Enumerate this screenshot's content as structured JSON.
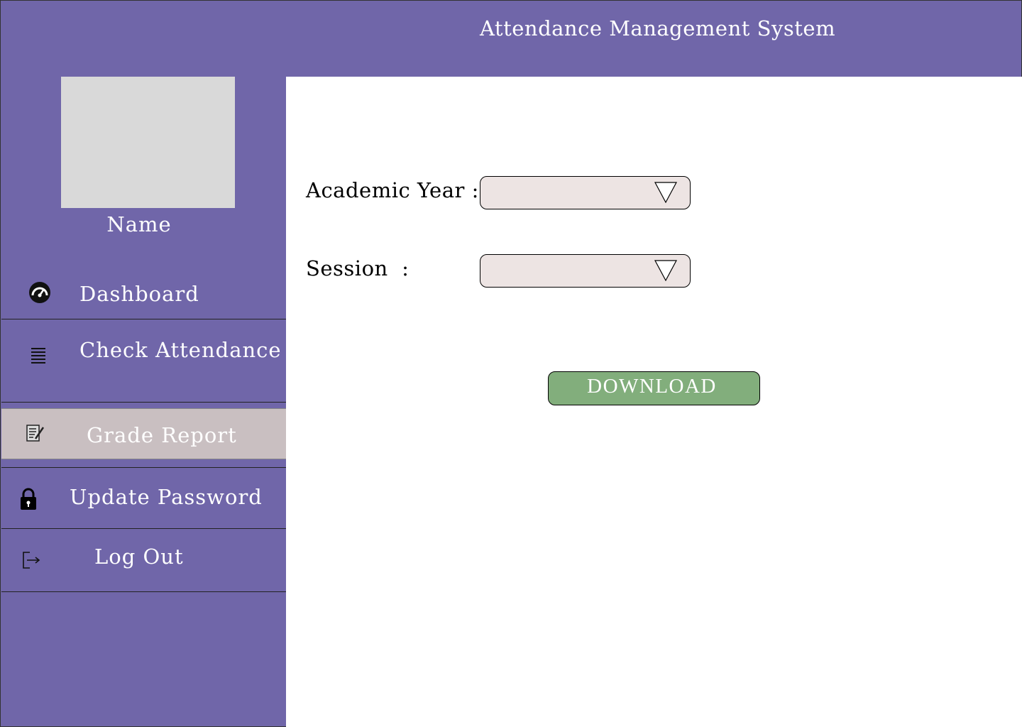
{
  "header": {
    "title": "Attendance Management System"
  },
  "profile": {
    "name": "Name"
  },
  "sidebar": {
    "items": [
      {
        "label": "Dashboard",
        "icon": "dashboard-gauge-icon"
      },
      {
        "label": "Check Attendance",
        "icon": "list-lines-icon"
      },
      {
        "label": "Grade Report",
        "icon": "document-edit-icon",
        "active": true
      },
      {
        "label": "Update Password",
        "icon": "lock-icon"
      },
      {
        "label": "Log Out",
        "icon": "logout-icon"
      }
    ]
  },
  "form": {
    "academic_year_label": "Academic Year :",
    "session_label": "Session  :",
    "academic_year_value": "",
    "session_value": "",
    "download_label": "DOWNLOAD"
  },
  "colors": {
    "header_sidebar": "#7066a9",
    "active_item": "#c9bfc1",
    "select_bg": "#ede4e3",
    "download_button": "#82ae7c"
  }
}
